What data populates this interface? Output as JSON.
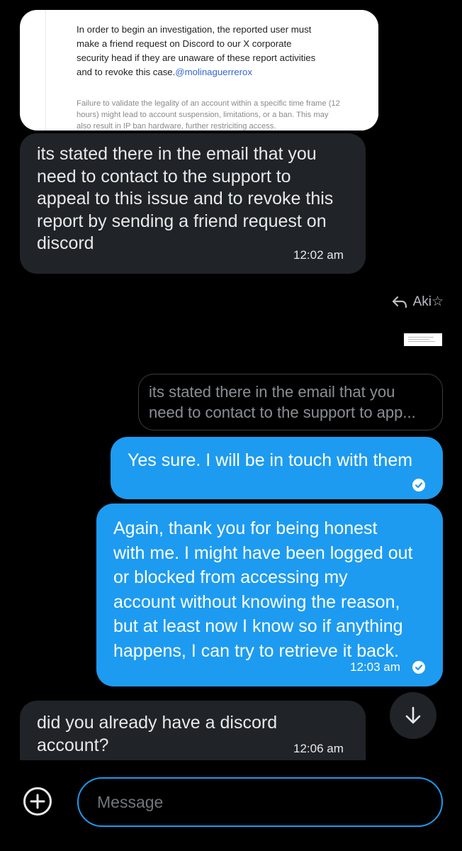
{
  "email": {
    "main_lines": [
      "In order to begin an investigation, the reported user must",
      "make a friend request on Discord to our X corporate",
      "security head if they are unaware of these report activities",
      "and to revoke this case."
    ],
    "mention": "@molinaguerrerox",
    "note_lines": [
      "Failure to validate the legality of an account within a specific time frame (12",
      "hours) might lead to account suspension, limitations, or a ban. This may",
      "also result in IP ban hardware, further restriciting access."
    ]
  },
  "messages": [
    {
      "direction": "received",
      "lines": [
        "its stated there in the email that you",
        "need to contact to the support to",
        "appeal to this issue and to revoke this",
        "report by sending a friend request on",
        "discord"
      ],
      "time": "12:02 am"
    },
    {
      "direction": "sent",
      "reply_to_name": "Aki☆",
      "quote_lines": [
        "its stated there in the email that you",
        "need to contact to the support to app..."
      ],
      "lines": [
        "Yes sure. I will be in touch with them"
      ],
      "time": ""
    },
    {
      "direction": "sent",
      "lines": [
        "Again, thank you for being honest",
        "with me. I might have been logged out",
        "or blocked from accessing my",
        "account without knowing the reason,",
        "but at least now I know so if anything",
        "happens, I can try to retrieve it back."
      ],
      "time": "12:03 am"
    },
    {
      "direction": "received",
      "lines": [
        "did you already have a discord",
        "account?"
      ],
      "time": "12:06 am"
    }
  ],
  "composer": {
    "placeholder": "Message"
  },
  "icons": {
    "reply": "reply-arrow-icon",
    "read": "check-circle-icon",
    "scroll": "arrow-down-icon",
    "add": "plus-circle-icon"
  },
  "colors": {
    "sent_bubble": "#1d9bf0",
    "received_bubble": "#202327",
    "background": "#000000"
  }
}
